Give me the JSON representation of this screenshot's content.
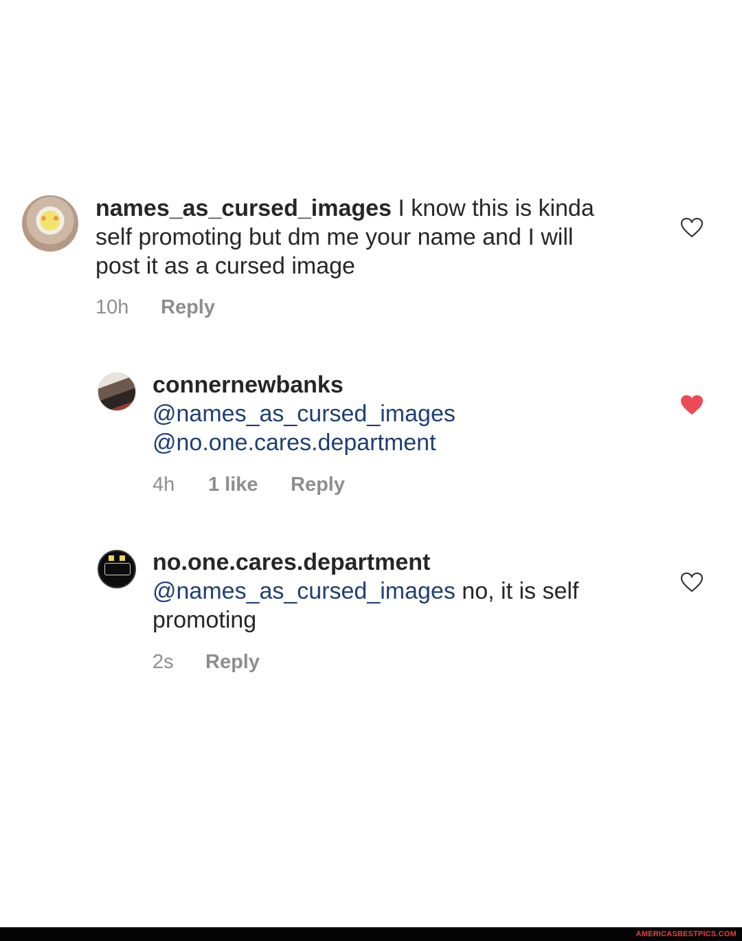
{
  "comments": [
    {
      "username": "names_as_cursed_images",
      "text_lines": [
        " I know this is kinda",
        "self promoting but dm me your name and I will",
        "post it as a cursed image"
      ],
      "time": "10h",
      "reply": "Reply",
      "liked": false
    },
    {
      "username": "connernewbanks",
      "mention_1": "@names_as_cursed_images",
      "mention_2": "@no.one.cares.department",
      "time": "4h",
      "likes": "1 like",
      "reply": "Reply",
      "liked": true
    },
    {
      "username": "no.one.cares.department",
      "mention": "@names_as_cursed_images",
      "text_after_mention": " no, it is self",
      "text_line_2": "promoting",
      "time": "2s",
      "reply": "Reply",
      "liked": false
    }
  ],
  "footer": {
    "watermark": "AMERICASBESTPICS.COM"
  },
  "colors": {
    "mention": "#1d3f73",
    "heart_liked": "#ed4956",
    "meta": "#8e8e8e"
  },
  "icons": [
    "heart-outline-icon",
    "heart-filled-icon"
  ]
}
